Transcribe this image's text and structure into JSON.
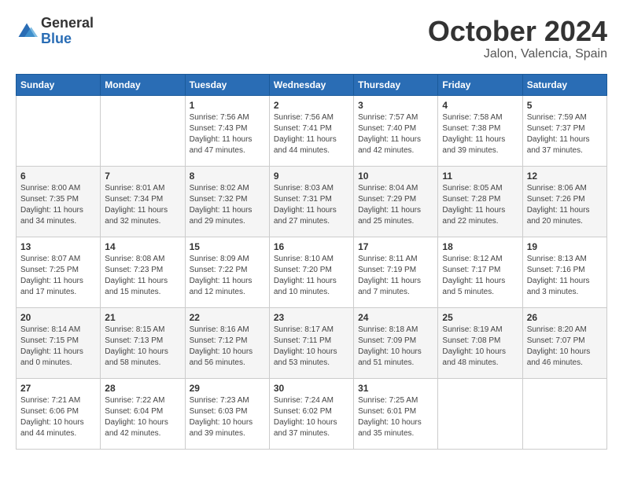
{
  "logo": {
    "general": "General",
    "blue": "Blue"
  },
  "title": "October 2024",
  "location": "Jalon, Valencia, Spain",
  "weekdays": [
    "Sunday",
    "Monday",
    "Tuesday",
    "Wednesday",
    "Thursday",
    "Friday",
    "Saturday"
  ],
  "weeks": [
    [
      {
        "day": "",
        "info": ""
      },
      {
        "day": "",
        "info": ""
      },
      {
        "day": "1",
        "info": "Sunrise: 7:56 AM\nSunset: 7:43 PM\nDaylight: 11 hours\nand 47 minutes."
      },
      {
        "day": "2",
        "info": "Sunrise: 7:56 AM\nSunset: 7:41 PM\nDaylight: 11 hours\nand 44 minutes."
      },
      {
        "day": "3",
        "info": "Sunrise: 7:57 AM\nSunset: 7:40 PM\nDaylight: 11 hours\nand 42 minutes."
      },
      {
        "day": "4",
        "info": "Sunrise: 7:58 AM\nSunset: 7:38 PM\nDaylight: 11 hours\nand 39 minutes."
      },
      {
        "day": "5",
        "info": "Sunrise: 7:59 AM\nSunset: 7:37 PM\nDaylight: 11 hours\nand 37 minutes."
      }
    ],
    [
      {
        "day": "6",
        "info": "Sunrise: 8:00 AM\nSunset: 7:35 PM\nDaylight: 11 hours\nand 34 minutes."
      },
      {
        "day": "7",
        "info": "Sunrise: 8:01 AM\nSunset: 7:34 PM\nDaylight: 11 hours\nand 32 minutes."
      },
      {
        "day": "8",
        "info": "Sunrise: 8:02 AM\nSunset: 7:32 PM\nDaylight: 11 hours\nand 29 minutes."
      },
      {
        "day": "9",
        "info": "Sunrise: 8:03 AM\nSunset: 7:31 PM\nDaylight: 11 hours\nand 27 minutes."
      },
      {
        "day": "10",
        "info": "Sunrise: 8:04 AM\nSunset: 7:29 PM\nDaylight: 11 hours\nand 25 minutes."
      },
      {
        "day": "11",
        "info": "Sunrise: 8:05 AM\nSunset: 7:28 PM\nDaylight: 11 hours\nand 22 minutes."
      },
      {
        "day": "12",
        "info": "Sunrise: 8:06 AM\nSunset: 7:26 PM\nDaylight: 11 hours\nand 20 minutes."
      }
    ],
    [
      {
        "day": "13",
        "info": "Sunrise: 8:07 AM\nSunset: 7:25 PM\nDaylight: 11 hours\nand 17 minutes."
      },
      {
        "day": "14",
        "info": "Sunrise: 8:08 AM\nSunset: 7:23 PM\nDaylight: 11 hours\nand 15 minutes."
      },
      {
        "day": "15",
        "info": "Sunrise: 8:09 AM\nSunset: 7:22 PM\nDaylight: 11 hours\nand 12 minutes."
      },
      {
        "day": "16",
        "info": "Sunrise: 8:10 AM\nSunset: 7:20 PM\nDaylight: 11 hours\nand 10 minutes."
      },
      {
        "day": "17",
        "info": "Sunrise: 8:11 AM\nSunset: 7:19 PM\nDaylight: 11 hours\nand 7 minutes."
      },
      {
        "day": "18",
        "info": "Sunrise: 8:12 AM\nSunset: 7:17 PM\nDaylight: 11 hours\nand 5 minutes."
      },
      {
        "day": "19",
        "info": "Sunrise: 8:13 AM\nSunset: 7:16 PM\nDaylight: 11 hours\nand 3 minutes."
      }
    ],
    [
      {
        "day": "20",
        "info": "Sunrise: 8:14 AM\nSunset: 7:15 PM\nDaylight: 11 hours\nand 0 minutes."
      },
      {
        "day": "21",
        "info": "Sunrise: 8:15 AM\nSunset: 7:13 PM\nDaylight: 10 hours\nand 58 minutes."
      },
      {
        "day": "22",
        "info": "Sunrise: 8:16 AM\nSunset: 7:12 PM\nDaylight: 10 hours\nand 56 minutes."
      },
      {
        "day": "23",
        "info": "Sunrise: 8:17 AM\nSunset: 7:11 PM\nDaylight: 10 hours\nand 53 minutes."
      },
      {
        "day": "24",
        "info": "Sunrise: 8:18 AM\nSunset: 7:09 PM\nDaylight: 10 hours\nand 51 minutes."
      },
      {
        "day": "25",
        "info": "Sunrise: 8:19 AM\nSunset: 7:08 PM\nDaylight: 10 hours\nand 48 minutes."
      },
      {
        "day": "26",
        "info": "Sunrise: 8:20 AM\nSunset: 7:07 PM\nDaylight: 10 hours\nand 46 minutes."
      }
    ],
    [
      {
        "day": "27",
        "info": "Sunrise: 7:21 AM\nSunset: 6:06 PM\nDaylight: 10 hours\nand 44 minutes."
      },
      {
        "day": "28",
        "info": "Sunrise: 7:22 AM\nSunset: 6:04 PM\nDaylight: 10 hours\nand 42 minutes."
      },
      {
        "day": "29",
        "info": "Sunrise: 7:23 AM\nSunset: 6:03 PM\nDaylight: 10 hours\nand 39 minutes."
      },
      {
        "day": "30",
        "info": "Sunrise: 7:24 AM\nSunset: 6:02 PM\nDaylight: 10 hours\nand 37 minutes."
      },
      {
        "day": "31",
        "info": "Sunrise: 7:25 AM\nSunset: 6:01 PM\nDaylight: 10 hours\nand 35 minutes."
      },
      {
        "day": "",
        "info": ""
      },
      {
        "day": "",
        "info": ""
      }
    ]
  ]
}
